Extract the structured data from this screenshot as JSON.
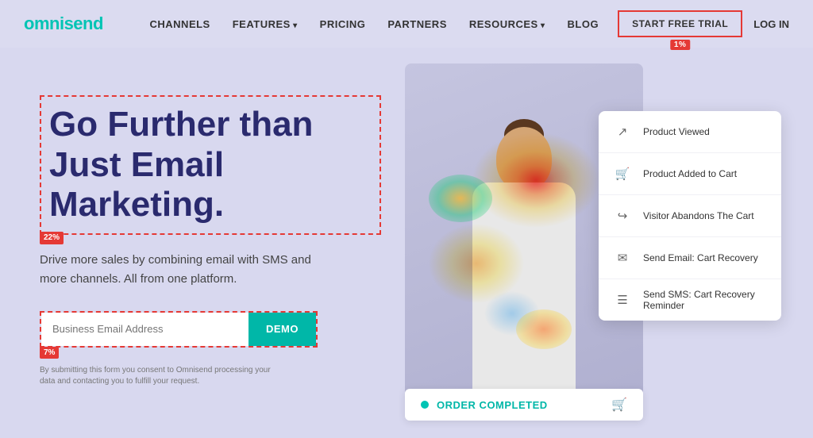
{
  "brand": {
    "name_start": "omni",
    "name_highlight": "send"
  },
  "nav": {
    "links": [
      {
        "label": "CHANNELS",
        "has_arrow": false
      },
      {
        "label": "FEATURES",
        "has_arrow": true
      },
      {
        "label": "PRICING",
        "has_arrow": false
      },
      {
        "label": "PARTNERS",
        "has_arrow": false
      },
      {
        "label": "RESOURCES",
        "has_arrow": true
      },
      {
        "label": "BLOG",
        "has_arrow": false
      }
    ],
    "cta_label": "START FREE TRIAL",
    "cta_badge": "1%",
    "login_label": "LOG IN"
  },
  "hero": {
    "heading": "Go Further than Just Email Marketing.",
    "heading_badge": "22%",
    "subtext": "Drive more sales by combining email with SMS and more channels. All from one platform.",
    "form_placeholder": "Business Email Address",
    "form_button": "DEMO",
    "form_badge": "7%",
    "form_note": "By submitting this form you consent to Omnisend processing your data and contacting you to fulfill your request."
  },
  "workflow": {
    "items": [
      {
        "icon": "cursor",
        "label": "Product Viewed"
      },
      {
        "icon": "cart",
        "label": "Product Added to Cart"
      },
      {
        "icon": "arrow",
        "label": "Visitor Abandons The Cart"
      },
      {
        "icon": "email",
        "label": "Send Email: Cart Recovery"
      },
      {
        "icon": "sms",
        "label": "Send SMS: Cart Recovery Reminder"
      }
    ],
    "order_label": "ORDER COMPLETED"
  }
}
